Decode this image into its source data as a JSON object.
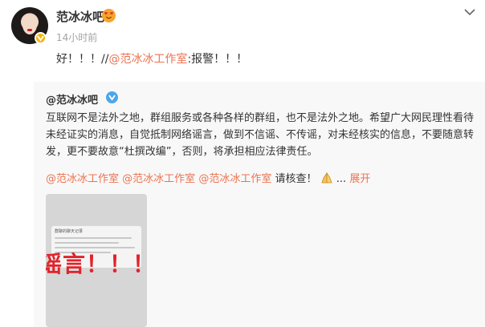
{
  "post": {
    "author": "范冰冰吧",
    "time": "14小时前",
    "text_prefix": "好！！！//",
    "mention": "@范冰冰工作室",
    "text_suffix": ":报警！！！"
  },
  "repost": {
    "author": "@范冰冰吧",
    "body": "互联网不是法外之地，群组服务或各种各样的群组，也不是法外之地。希望广大网民理性看待未经证实的消息，自觉抵制网络谣言，做到不信谣、不传谣，对未经核实的信息，不要随意转发，更不要故意“杜撰改编”，否则，将承担相应法律责任。",
    "mentions": [
      "@范冰冰工作室",
      "@范冰冰工作室",
      "@范冰冰工作室"
    ],
    "request_text": "请核查！",
    "ellipsis": "...",
    "expand_label": "展开",
    "image": {
      "chat_title": "群聊的聊天记录",
      "overlay_text": "谣言！！！"
    }
  },
  "icons": {
    "verified": "verified-badge-icon",
    "fan": "heart-eyes-badge-icon",
    "more": "chevron-down-icon",
    "pray": "praying-hands-icon"
  },
  "colors": {
    "mention": "#eb7350",
    "verified_gold": "#f7b40b",
    "verified_blue": "#4ca7e9",
    "rumor_red": "#e3222a"
  }
}
